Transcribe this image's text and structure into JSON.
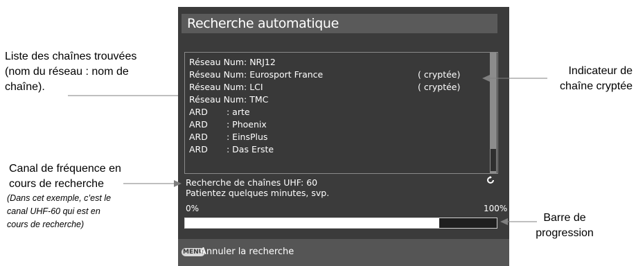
{
  "screen": {
    "title": "Recherche automatique",
    "channels": [
      {
        "network": "Réseau Num: NRJ12",
        "crypt": ""
      },
      {
        "network": "Réseau Num: Eurosport France",
        "crypt": "( cryptée)"
      },
      {
        "network": "Réseau Num: LCI",
        "crypt": "( cryptée)"
      },
      {
        "network": "Réseau Num: TMC",
        "crypt": ""
      },
      {
        "network": "ARD",
        "name": ": arte",
        "crypt": ""
      },
      {
        "network": "ARD",
        "name": ": Phoenix",
        "crypt": ""
      },
      {
        "network": "ARD",
        "name": ": EinsPlus",
        "crypt": ""
      },
      {
        "network": "ARD",
        "name": ": Das Erste",
        "crypt": ""
      }
    ],
    "status_line1": "Recherche de chaînes UHF: 60",
    "status_line2": "Patientez quelques minutes, svp.",
    "progress_min_label": "0%",
    "progress_max_label": "100%",
    "progress_fraction": 0.815,
    "footer_key": "MENU",
    "footer_label": "Annuler la recherche",
    "refresh_icon": "refresh-icon"
  },
  "annotations": {
    "channel_list_line1": "Liste des chaînes trouvées",
    "channel_list_line2": "(nom du réseau : nom de",
    "channel_list_line3": "chaîne).",
    "crypt_line1": "Indicateur de",
    "crypt_line2": "chaîne cryptée",
    "freq_line1": "Canal de fréquence en",
    "freq_line2": "cours de recherche",
    "freq_note1": "(Dans cet exemple, c’est le",
    "freq_note2": "canal UHF-60 qui est en",
    "freq_note3": "cours de recherche)",
    "progress_line1": "Barre de",
    "progress_line2": "progression"
  },
  "colors": {
    "screen_bg": "#3b3b3b",
    "title_bg": "#5a5a5a",
    "footer_bg": "#555555",
    "text": "#ffffff",
    "leader_line": "#7f7f7f"
  }
}
